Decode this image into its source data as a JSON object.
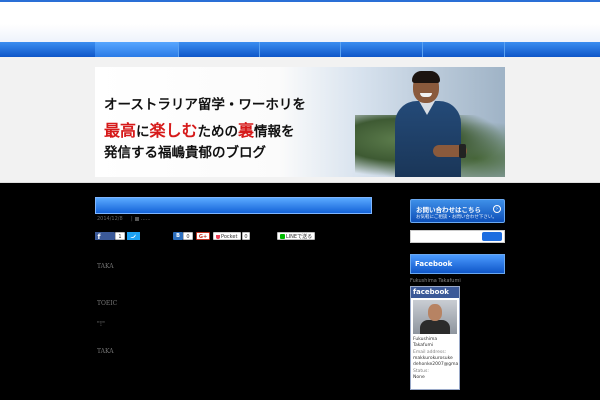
{
  "header": {
    "nav_items": [
      "",
      "",
      "",
      "",
      "",
      ""
    ]
  },
  "banner": {
    "line1": "オーストラリア留学・ワーホリを",
    "line2_parts": [
      "最高",
      "に",
      "楽しむ",
      "ための",
      "裏",
      "情報",
      "を"
    ],
    "line3": "発信する福嶋貴郁のブログ"
  },
  "post": {
    "date": "2014/12/8",
    "separator": "|",
    "category": "......",
    "share": {
      "fb_count": "1",
      "hatena_label": "B",
      "hatena_count": "0",
      "gplus_label": "G+",
      "pocket_label": "Pocket",
      "pocket_count": "0",
      "line_label": "LINEで送る"
    },
    "body_lines": [
      "TAKA",
      "TOEIC",
      "\"!\"",
      "TAKA"
    ]
  },
  "sidebar": {
    "contact_title": "お問い合わせはこちら",
    "contact_sub": "お気軽にご相談・お問い合わせ下さい。",
    "contact_arrow": "›",
    "facebook_heading": "Facebook",
    "fb_user": "Fukushima Takafumi",
    "fb_badge_title": "facebook",
    "fb_name_line1": "Fukushima",
    "fb_name_line2": "Takafumi",
    "fb_email_label": "Email address:",
    "fb_email_line1": "makkurokurosuke",
    "fb_email_line2": "dehonke2007@gma",
    "fb_status_label": "Status:",
    "fb_status_value": "None"
  },
  "colors": {
    "accent_blue": "#1463d8",
    "background": "#000000",
    "hero_band": "#f2f2f2",
    "facebook_blue": "#3b5998"
  },
  "icons": [
    "facebook-icon",
    "twitter-icon",
    "hatena-icon",
    "gplus-icon",
    "pocket-icon",
    "line-icon",
    "search-icon",
    "arrow-circle-icon"
  ]
}
